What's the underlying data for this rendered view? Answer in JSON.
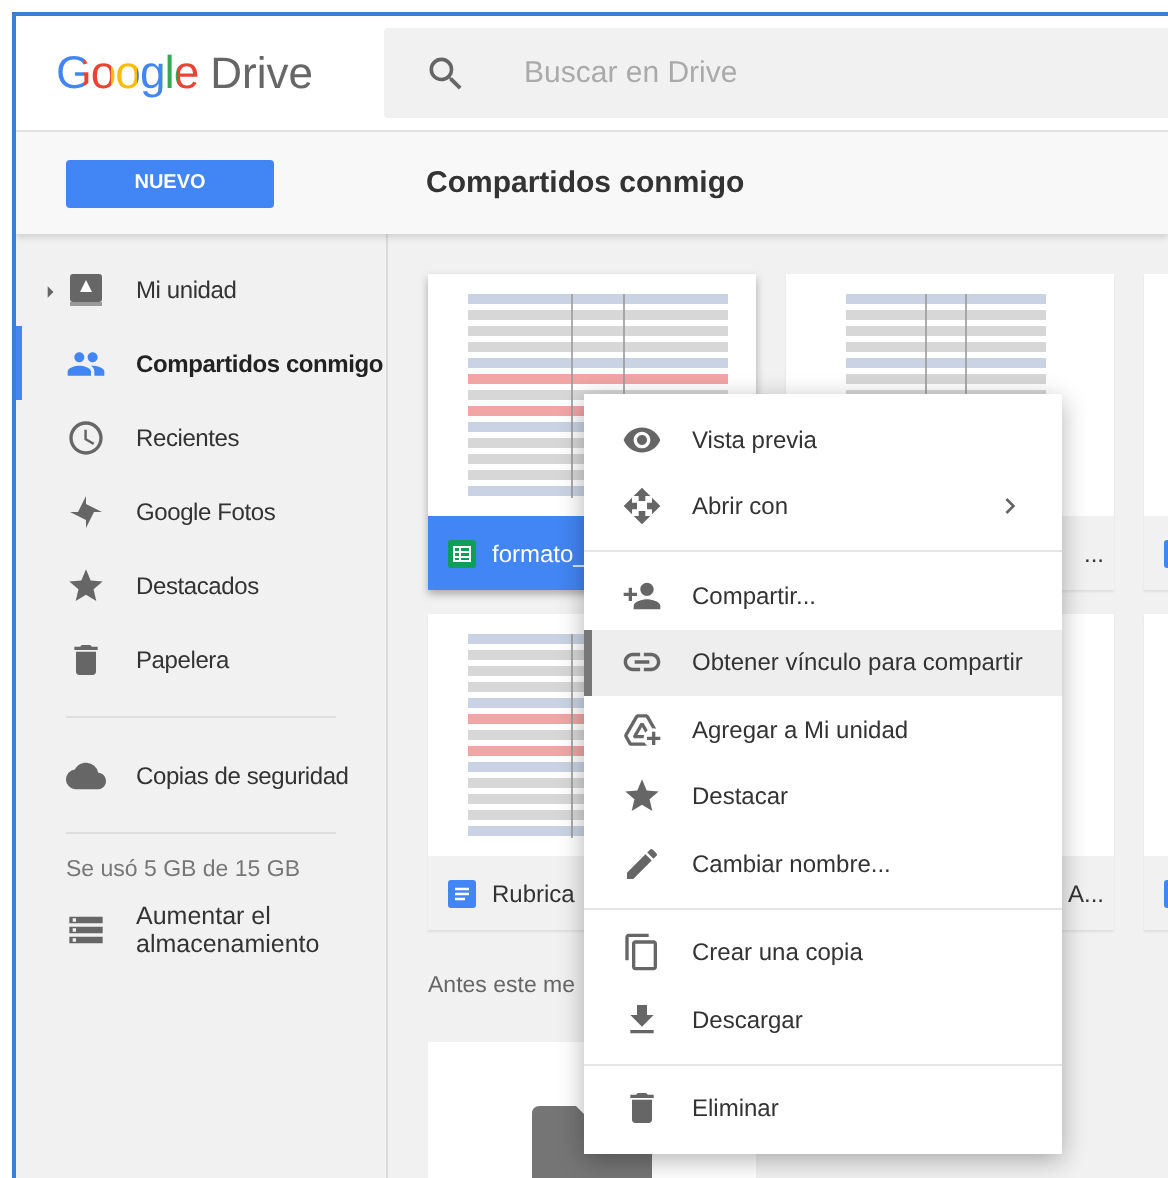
{
  "header": {
    "logo_brand": "Google",
    "logo_product": "Drive",
    "search": {
      "placeholder": "Buscar en Drive"
    }
  },
  "toolbar": {
    "new_button": "NUEVO",
    "title": "Compartidos conmigo"
  },
  "sidebar": {
    "items": [
      {
        "label": "Mi unidad",
        "kind": "folder",
        "selected": false
      },
      {
        "label": "Compartidos conmigo",
        "kind": "link",
        "selected": true
      },
      {
        "label": "Recientes",
        "kind": "link",
        "selected": false
      },
      {
        "label": "Google Fotos",
        "kind": "link",
        "selected": false
      },
      {
        "label": "Destacados",
        "kind": "link",
        "selected": false
      },
      {
        "label": "Papelera",
        "kind": "link",
        "selected": false
      }
    ],
    "backup": "Copias de seguridad",
    "storage_text": "Se usó 5 GB de 15 GB",
    "upgrade": "Aumentar el almacenamiento"
  },
  "files": [
    {
      "name": "formato_",
      "kind": "sheet",
      "selected": true,
      "clipped": false
    },
    {
      "name": "...",
      "selected": false,
      "clipped": true
    },
    {
      "kind": "doc",
      "selected": false
    },
    {
      "name": "Rubrica",
      "kind": "doc",
      "selected": false,
      "clipped": false
    },
    {
      "name": "A...",
      "selected": false,
      "clipped": true
    },
    {
      "kind": "doc",
      "selected": false
    }
  ],
  "section_label": "Antes este me",
  "context_menu": {
    "groups": [
      [
        {
          "label": "Vista previa",
          "selected": false,
          "has_submenu": false
        },
        {
          "label": "Abrir con",
          "selected": false,
          "has_submenu": true
        }
      ],
      [
        {
          "label": "Compartir...",
          "selected": false,
          "has_submenu": false
        },
        {
          "label": "Obtener vínculo para compartir",
          "selected": true,
          "has_submenu": false
        },
        {
          "label": "Agregar a Mi unidad",
          "selected": false,
          "has_submenu": false
        },
        {
          "label": "Destacar",
          "selected": false,
          "has_submenu": false
        },
        {
          "label": "Cambiar nombre...",
          "selected": false,
          "has_submenu": false
        }
      ],
      [
        {
          "label": "Crear una copia",
          "selected": false,
          "has_submenu": false
        },
        {
          "label": "Descargar",
          "selected": false,
          "has_submenu": false
        }
      ],
      [
        {
          "label": "Eliminar",
          "selected": false,
          "has_submenu": false
        }
      ]
    ]
  }
}
